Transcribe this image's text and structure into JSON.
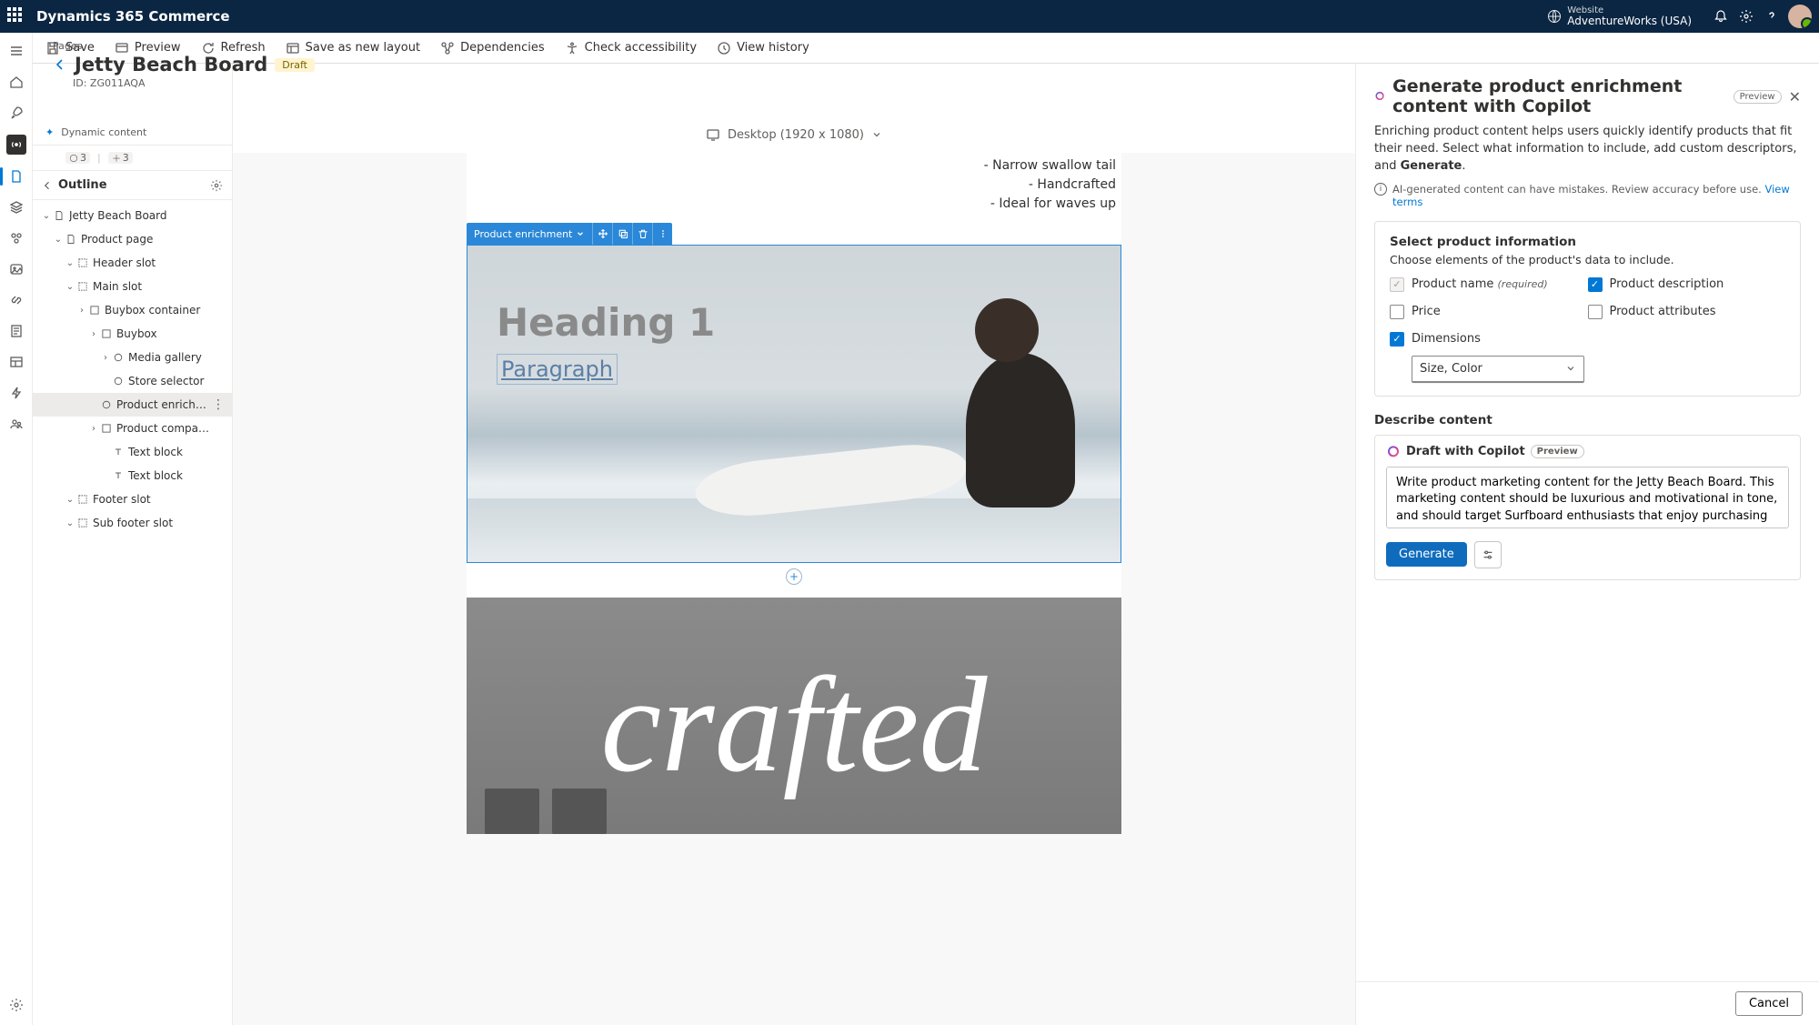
{
  "appbar": {
    "brand": "Dynamics 365 Commerce",
    "website_label": "Website",
    "website_value": "AdventureWorks (USA)"
  },
  "commandbar": {
    "save": "Save",
    "preview": "Preview",
    "refresh": "Refresh",
    "save_layout": "Save as new layout",
    "dependencies": "Dependencies",
    "check_a11y": "Check accessibility",
    "view_history": "View history"
  },
  "page": {
    "breadcrumb": "Pages",
    "title": "Jetty Beach Board",
    "status": "Draft",
    "identifier": "ID: ZG011AQA"
  },
  "dynamic": {
    "label": "Dynamic content",
    "count_a": "3",
    "count_b": "3"
  },
  "viewport": {
    "label": "Desktop (1920 x 1080)"
  },
  "outline": {
    "label": "Outline",
    "nodes": [
      {
        "depth": 0,
        "tw": "v",
        "icon": "page",
        "label": "Jetty Beach Board"
      },
      {
        "depth": 1,
        "tw": "v",
        "icon": "page",
        "label": "Product page"
      },
      {
        "depth": 2,
        "tw": "v",
        "icon": "slot",
        "label": "Header slot"
      },
      {
        "depth": 2,
        "tw": "v",
        "icon": "slot",
        "label": "Main slot"
      },
      {
        "depth": 3,
        "tw": ">",
        "icon": "mod",
        "label": "Buybox container"
      },
      {
        "depth": 4,
        "tw": ">",
        "icon": "mod",
        "label": "Buybox"
      },
      {
        "depth": 5,
        "tw": ">",
        "icon": "circ",
        "label": "Media gallery"
      },
      {
        "depth": 5,
        "tw": "",
        "icon": "circ",
        "label": "Store selector"
      },
      {
        "depth": 4,
        "tw": "",
        "icon": "circ",
        "label": "Product enrichment",
        "sel": true
      },
      {
        "depth": 4,
        "tw": ">",
        "icon": "mod",
        "label": "Product comparison bu..."
      },
      {
        "depth": 5,
        "tw": "",
        "icon": "txt",
        "label": "Text block"
      },
      {
        "depth": 5,
        "tw": "",
        "icon": "txt",
        "label": "Text block"
      },
      {
        "depth": 2,
        "tw": "v",
        "icon": "slot",
        "label": "Footer slot"
      },
      {
        "depth": 2,
        "tw": "v",
        "icon": "slot",
        "label": "Sub footer slot"
      }
    ]
  },
  "canvas": {
    "features": [
      "- Narrow swallow tail",
      "- Handcrafted",
      "- Ideal for waves up"
    ],
    "module_tag": "Product enrichment",
    "heading": "Heading 1",
    "paragraph": "Paragraph",
    "crafted": "crafted"
  },
  "panel": {
    "title": "Generate product enrichment content with Copilot",
    "preview": "Preview",
    "intro": "Enriching product content helps users quickly identify products that fit their need. Select what information to include, add custom descriptors, and ",
    "intro_bold": "Generate",
    "intro_tail": ".",
    "disclaimer": "AI-generated content can have mistakes. Review accuracy before use.",
    "view_terms": "View terms",
    "select_title": "Select product information",
    "select_sub": "Choose elements of the product's data to include.",
    "opts": {
      "product_name": "Product name",
      "product_name_req": "(required)",
      "product_description": "Product description",
      "price": "Price",
      "product_attributes": "Product attributes",
      "dimensions": "Dimensions",
      "dimensions_value": "Size, Color"
    },
    "describe": "Describe content",
    "draft_label": "Draft with Copilot",
    "draft_text": "Write product marketing content for the Jetty Beach Board. This marketing content should be luxurious and motivational in tone, and should target Surfboard enthusiasts that enjoy purchasing luxury products.",
    "generate": "Generate",
    "cancel": "Cancel"
  }
}
